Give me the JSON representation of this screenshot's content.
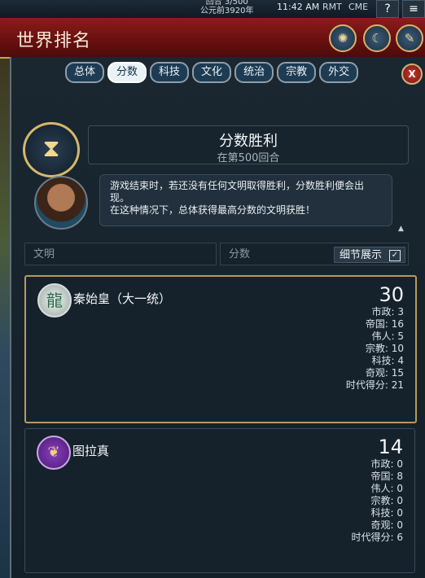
{
  "topbar": {
    "turn_line1": "回合 3/500",
    "turn_line2": "公元前3920年",
    "clock": "11:42 AM",
    "rmt": "RMT",
    "cme": "CME",
    "help_icon": "?",
    "menu_icon": "≡"
  },
  "banner": {
    "title": "世界排名"
  },
  "tabs": [
    "总体",
    "分数",
    "科技",
    "文化",
    "统治",
    "宗教",
    "外交"
  ],
  "active_tab": "分数",
  "victory": {
    "title": "分数胜利",
    "subtitle": "在第500回合",
    "desc_line1": "游戏结束时，若还没有任何文明取得胜利，分数胜利便会出现。",
    "desc_line2": "在这种情况下，总体获得最高分数的文明获胜！"
  },
  "header": {
    "civ_label": "文明",
    "score_label": "分数",
    "detail_label": "细节展示"
  },
  "civs": [
    {
      "name": "秦始皇（大一统）",
      "score": "30",
      "rows": [
        "市政: 3",
        "帝国: 16",
        "伟人: 5",
        "宗教: 10",
        "科技: 4",
        "奇观: 15",
        "时代得分: 21"
      ]
    },
    {
      "name": "图拉真",
      "score": "14",
      "rows": [
        "市政: 0",
        "帝国: 8",
        "伟人: 0",
        "宗教: 0",
        "科技: 0",
        "奇观: 0",
        "时代得分: 6"
      ]
    }
  ],
  "colors": {
    "banner": "#8c1c1c",
    "gold": "#d6b86a",
    "panel": "#1a2731"
  }
}
